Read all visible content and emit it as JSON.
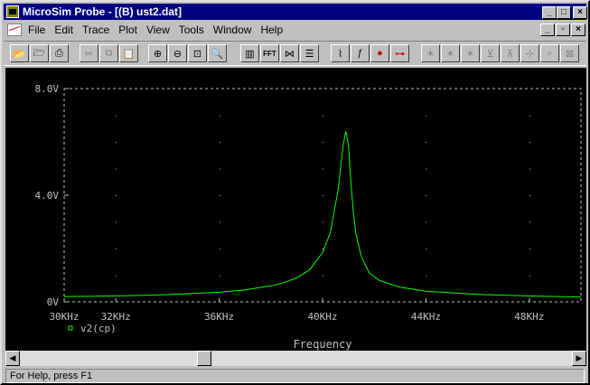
{
  "window": {
    "title": "MicroSim Probe - [(B) ust2.dat]"
  },
  "menu": {
    "items": [
      {
        "id": "file",
        "label": "File"
      },
      {
        "id": "edit",
        "label": "Edit"
      },
      {
        "id": "trace",
        "label": "Trace"
      },
      {
        "id": "plot",
        "label": "Plot"
      },
      {
        "id": "view",
        "label": "View"
      },
      {
        "id": "tools",
        "label": "Tools"
      },
      {
        "id": "window",
        "label": "Window"
      },
      {
        "id": "help",
        "label": "Help"
      }
    ]
  },
  "toolbar": {
    "fft_label": "FFT"
  },
  "colors": {
    "plot_bg": "#000000",
    "trace": "#00ff00",
    "axis": "#c0c0c0",
    "grid": "#c0c0c0",
    "title_bar": "#000080"
  },
  "chart_data": {
    "type": "line",
    "xlabel": "Frequency",
    "x_ticks": [
      "30KHz",
      "32KHz",
      "36KHz",
      "40KHz",
      "44KHz",
      "48KHz"
    ],
    "x_tick_values": [
      30000,
      32000,
      36000,
      40000,
      44000,
      48000
    ],
    "y_ticks": [
      "0V",
      "4.0V",
      "8.0V"
    ],
    "y_tick_values": [
      0,
      4,
      8
    ],
    "xlim": [
      30000,
      50000
    ],
    "ylim": [
      0,
      8
    ],
    "grid": true,
    "legend": "bottom-left",
    "series": [
      {
        "name": "v2(cp)",
        "x": [
          30000,
          32000,
          34000,
          36000,
          37000,
          38000,
          38500,
          39000,
          39500,
          40000,
          40300,
          40600,
          40800,
          40900,
          41000,
          41100,
          41200,
          41300,
          41500,
          41800,
          42200,
          43000,
          44000,
          46000,
          48000,
          50000
        ],
        "y": [
          0.2,
          0.22,
          0.27,
          0.36,
          0.45,
          0.6,
          0.72,
          0.9,
          1.2,
          1.85,
          2.6,
          4.2,
          5.9,
          6.4,
          5.9,
          4.4,
          3.3,
          2.5,
          1.7,
          1.1,
          0.8,
          0.55,
          0.4,
          0.28,
          0.22,
          0.18
        ]
      }
    ]
  },
  "scrollbar": {
    "value": 0.33
  },
  "status": {
    "text": "For Help, press F1"
  }
}
